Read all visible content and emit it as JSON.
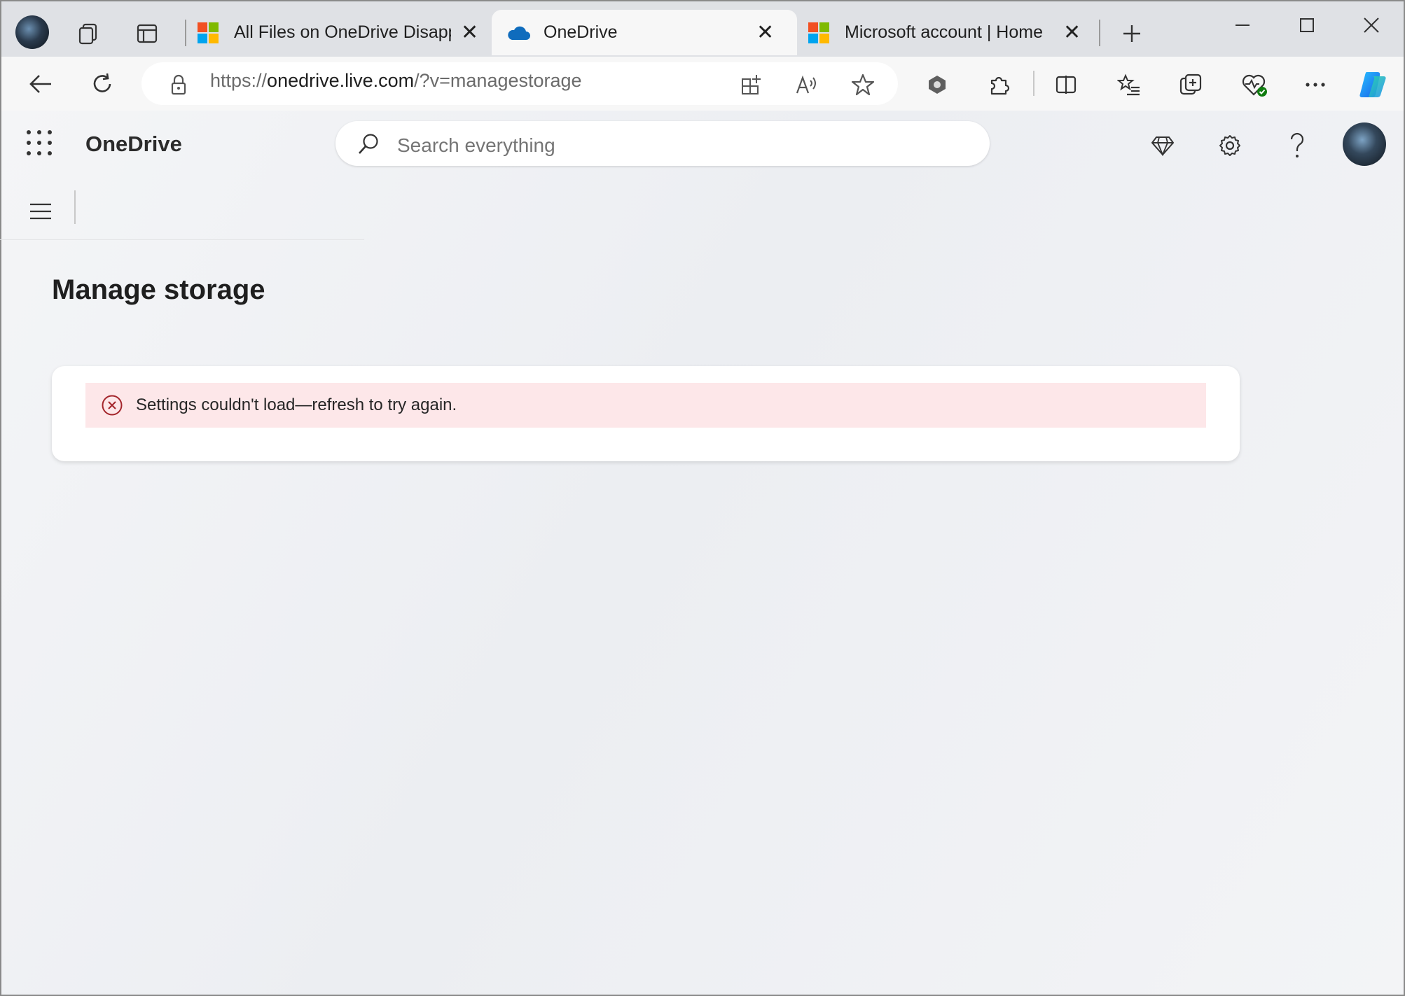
{
  "browser": {
    "tabs": [
      {
        "label": "All Files on OneDrive Disappe",
        "icon": "microsoft-logo-icon"
      },
      {
        "label": "OneDrive",
        "icon": "onedrive-cloud-icon",
        "active": true
      },
      {
        "label": "Microsoft account | Home",
        "icon": "microsoft-logo-icon"
      }
    ],
    "address": {
      "prefix": "https://",
      "domain": "onedrive.live.com",
      "path": "/?v=managestorage"
    }
  },
  "app": {
    "brand": "OneDrive",
    "search_placeholder": "Search everything"
  },
  "main": {
    "page_title": "Manage storage",
    "error_message": "Settings couldn't load—refresh to try again."
  },
  "colors": {
    "error_bg": "#fde7e9",
    "error_icon": "#a4262c",
    "onedrive_blue": "#0f6cbd",
    "copilot_gradient": "#2f8ef3"
  }
}
